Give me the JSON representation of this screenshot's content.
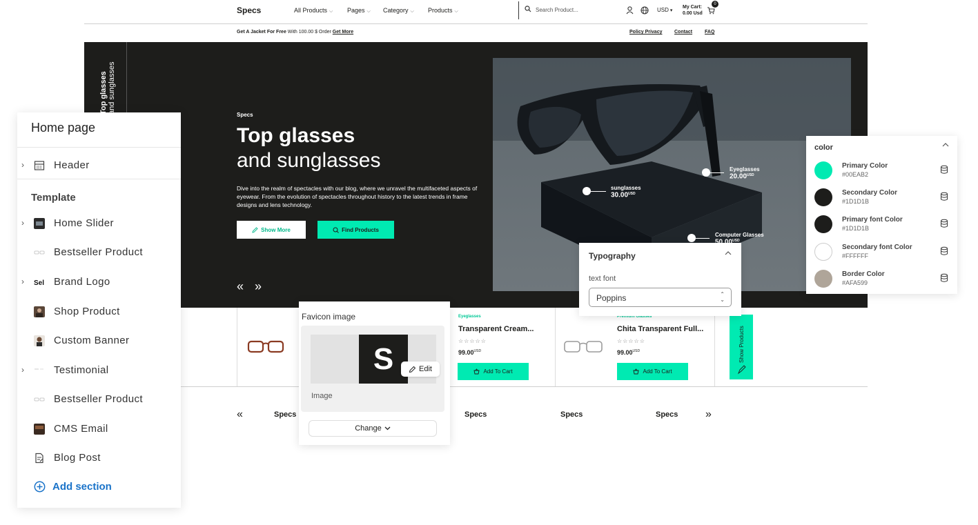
{
  "storefront": {
    "brand": "Specs",
    "nav": [
      "All Products",
      "Pages",
      "Category",
      "Products"
    ],
    "search_placeholder": "Search Product...",
    "currency": "USD",
    "cart_label": "My Cart:",
    "cart_total": "0.00 Usd",
    "cart_count": "0",
    "promo_bold": "Get A Jacket For Free",
    "promo_text": "With 100.00 $ Order",
    "promo_link": "Get More",
    "top_links": [
      "Policy Privacy",
      "Contact",
      "FAQ"
    ],
    "hero": {
      "vertical_line1": "Top glasses",
      "vertical_line2": "and sunglasses",
      "eyebrow": "Specs",
      "title_line1": "Top glasses",
      "title_line2": "and sunglasses",
      "description": "Dive into the realm of spectacles with our blog, where we unravel the multifaceted aspects of eyewear. From the evolution of spectacles throughout history to the latest trends in frame designs and lens technology.",
      "btn_show_more": "Show More",
      "btn_find_products": "Find Products",
      "prev": "«",
      "next": "»",
      "hotspots": [
        {
          "name": "Eyeglasses",
          "price": "20.00",
          "unit": "USD"
        },
        {
          "name": "sunglasses",
          "price": "30.00",
          "unit": "USD"
        },
        {
          "name": "Computer Glasses",
          "price": "50.00",
          "unit": "USD"
        }
      ]
    },
    "products": [
      {
        "category": "Eyeglasses",
        "name": "Transparent Cream...",
        "stars": "☆☆☆☆☆",
        "price": "99.00",
        "unit": "USD",
        "button": "Add To Cart"
      },
      {
        "category": "Premium Glasses",
        "name": "Chita Transparent Full...",
        "stars": "☆☆☆☆☆",
        "price": "99.00",
        "unit": "USD",
        "button": "Add To Cart"
      }
    ],
    "show_products": "Show Products",
    "brand_strip": {
      "prev": "«",
      "next": "»",
      "logos": [
        "Specs",
        "Specs",
        "Specs",
        "Specs"
      ]
    }
  },
  "left_panel": {
    "title": "Home page",
    "header_item": "Header",
    "section_title": "Template",
    "items": [
      "Home Slider",
      "Bestseller Product",
      "Brand Logo",
      "Shop Product",
      "Custom Banner",
      "Testimonial",
      "Bestseller Product",
      "CMS Email",
      "Blog Post"
    ],
    "add_section": "Add section"
  },
  "favicon_popup": {
    "title": "Favicon image",
    "letter": "S",
    "edit": "Edit",
    "image_label": "Image",
    "change": "Change"
  },
  "typography": {
    "title": "Typography",
    "label": "text font",
    "value": "Poppins"
  },
  "color_panel": {
    "title": "color",
    "colors": [
      {
        "name": "Primary Color",
        "hex": "#00EAB2"
      },
      {
        "name": "Secondary Color",
        "hex": "#1D1D1B"
      },
      {
        "name": "Primary font Color",
        "hex": "#1D1D1B"
      },
      {
        "name": "Secondary font Color",
        "hex": "#FFFFFF"
      },
      {
        "name": "Border Color",
        "hex": "#AFA599"
      }
    ]
  }
}
